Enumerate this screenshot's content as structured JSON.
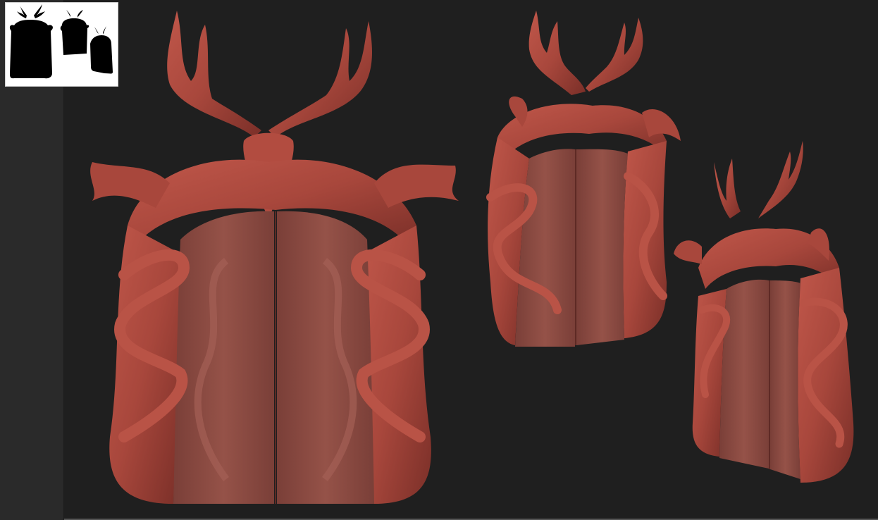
{
  "app": {
    "viewport_background": "#1f1f1f",
    "tray_background": "#2a2a2a"
  },
  "thumbnail": {
    "silhouette_color": "#000000",
    "background": "#ffffff",
    "icons": [
      "doorway-silhouette-large",
      "doorway-silhouette-medium",
      "doorway-silhouette-small"
    ]
  },
  "models": {
    "material_color": "#a8473c",
    "door_color": "#8a4a43",
    "items": [
      "doorway-sculpt-front",
      "doorway-sculpt-angled",
      "doorway-sculpt-side"
    ]
  }
}
